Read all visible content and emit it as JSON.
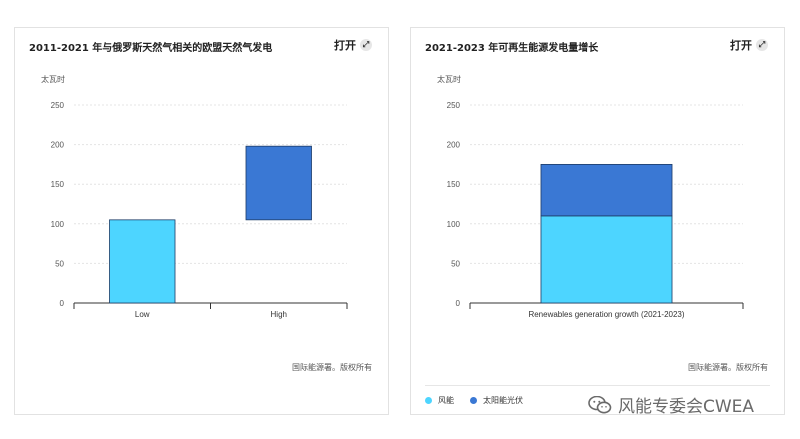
{
  "charts": {
    "left": {
      "title": "2011-2021 年与俄罗斯天然气相关的欧盟天然气发电",
      "open_label": "打开",
      "unit": "太瓦时",
      "source": "国际能源署。版权所有"
    },
    "right": {
      "title": "2021-2023 年可再生能源发电量增长",
      "open_label": "打开",
      "unit": "太瓦时",
      "source": "国际能源署。版权所有",
      "legend": [
        {
          "label": "风能",
          "color": "#4dd5ff"
        },
        {
          "label": "太阳能光伏",
          "color": "#3a78d4"
        }
      ]
    }
  },
  "watermark": "风能专委会CWEA",
  "chart_data": [
    {
      "type": "bar",
      "subtype": "waterfall",
      "title": "2011-2021 年与俄罗斯天然气相关的欧盟天然气发电",
      "ylabel": "太瓦时",
      "categories": [
        "Low",
        "High"
      ],
      "bars": [
        {
          "category": "Low",
          "start": 0,
          "end": 105,
          "color": "#4dd5ff"
        },
        {
          "category": "High",
          "start": 105,
          "end": 198,
          "color": "#3a78d4"
        }
      ],
      "ylim": [
        0,
        250
      ],
      "yticks": [
        0,
        50,
        100,
        150,
        200,
        250
      ],
      "grid": true
    },
    {
      "type": "bar",
      "subtype": "stacked",
      "title": "2021-2023 年可再生能源发电量增长",
      "ylabel": "太瓦时",
      "categories": [
        "Renewables generation growth (2021-2023)"
      ],
      "series": [
        {
          "name": "风能",
          "values": [
            110
          ],
          "color": "#4dd5ff"
        },
        {
          "name": "太阳能光伏",
          "values": [
            65
          ],
          "color": "#3a78d4"
        }
      ],
      "ylim": [
        0,
        250
      ],
      "yticks": [
        0,
        50,
        100,
        150,
        200,
        250
      ],
      "grid": true,
      "legend": "bottom-left"
    }
  ]
}
